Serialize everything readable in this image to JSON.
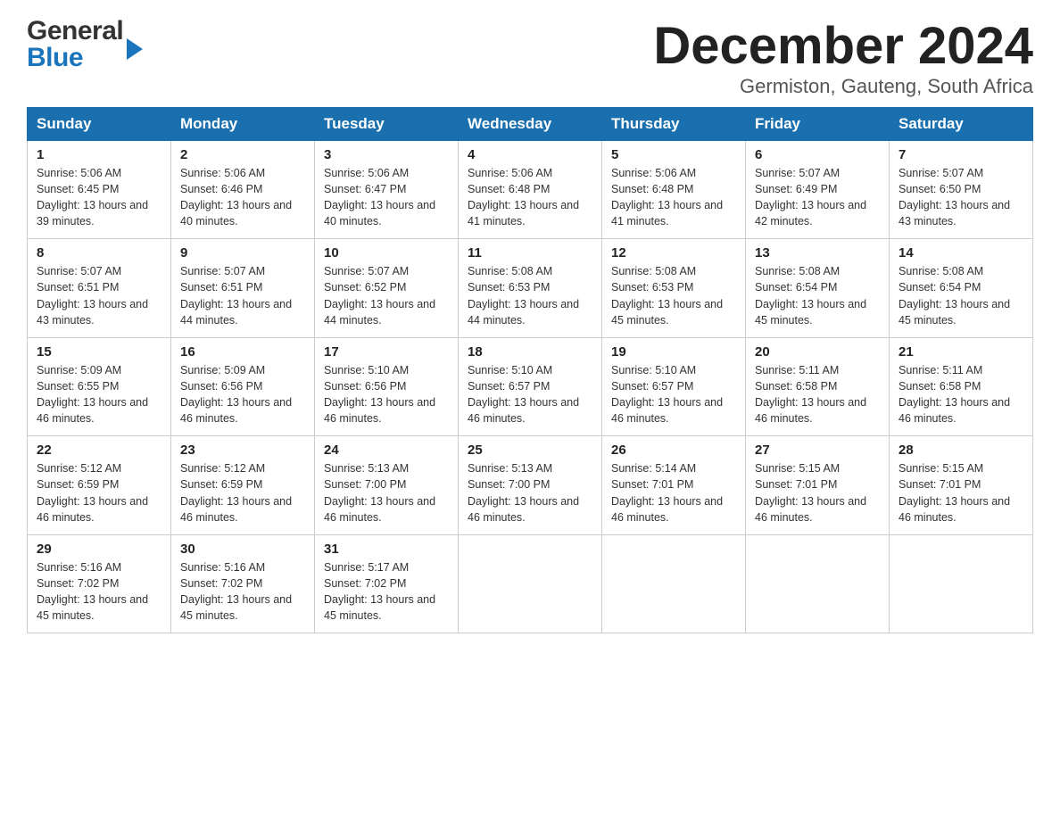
{
  "header": {
    "logo_general": "General",
    "logo_blue": "Blue",
    "month_title": "December 2024",
    "location": "Germiston, Gauteng, South Africa"
  },
  "calendar": {
    "days_of_week": [
      "Sunday",
      "Monday",
      "Tuesday",
      "Wednesday",
      "Thursday",
      "Friday",
      "Saturday"
    ],
    "weeks": [
      [
        {
          "day": "1",
          "sunrise": "5:06 AM",
          "sunset": "6:45 PM",
          "daylight": "13 hours and 39 minutes."
        },
        {
          "day": "2",
          "sunrise": "5:06 AM",
          "sunset": "6:46 PM",
          "daylight": "13 hours and 40 minutes."
        },
        {
          "day": "3",
          "sunrise": "5:06 AM",
          "sunset": "6:47 PM",
          "daylight": "13 hours and 40 minutes."
        },
        {
          "day": "4",
          "sunrise": "5:06 AM",
          "sunset": "6:48 PM",
          "daylight": "13 hours and 41 minutes."
        },
        {
          "day": "5",
          "sunrise": "5:06 AM",
          "sunset": "6:48 PM",
          "daylight": "13 hours and 41 minutes."
        },
        {
          "day": "6",
          "sunrise": "5:07 AM",
          "sunset": "6:49 PM",
          "daylight": "13 hours and 42 minutes."
        },
        {
          "day": "7",
          "sunrise": "5:07 AM",
          "sunset": "6:50 PM",
          "daylight": "13 hours and 43 minutes."
        }
      ],
      [
        {
          "day": "8",
          "sunrise": "5:07 AM",
          "sunset": "6:51 PM",
          "daylight": "13 hours and 43 minutes."
        },
        {
          "day": "9",
          "sunrise": "5:07 AM",
          "sunset": "6:51 PM",
          "daylight": "13 hours and 44 minutes."
        },
        {
          "day": "10",
          "sunrise": "5:07 AM",
          "sunset": "6:52 PM",
          "daylight": "13 hours and 44 minutes."
        },
        {
          "day": "11",
          "sunrise": "5:08 AM",
          "sunset": "6:53 PM",
          "daylight": "13 hours and 44 minutes."
        },
        {
          "day": "12",
          "sunrise": "5:08 AM",
          "sunset": "6:53 PM",
          "daylight": "13 hours and 45 minutes."
        },
        {
          "day": "13",
          "sunrise": "5:08 AM",
          "sunset": "6:54 PM",
          "daylight": "13 hours and 45 minutes."
        },
        {
          "day": "14",
          "sunrise": "5:08 AM",
          "sunset": "6:54 PM",
          "daylight": "13 hours and 45 minutes."
        }
      ],
      [
        {
          "day": "15",
          "sunrise": "5:09 AM",
          "sunset": "6:55 PM",
          "daylight": "13 hours and 46 minutes."
        },
        {
          "day": "16",
          "sunrise": "5:09 AM",
          "sunset": "6:56 PM",
          "daylight": "13 hours and 46 minutes."
        },
        {
          "day": "17",
          "sunrise": "5:10 AM",
          "sunset": "6:56 PM",
          "daylight": "13 hours and 46 minutes."
        },
        {
          "day": "18",
          "sunrise": "5:10 AM",
          "sunset": "6:57 PM",
          "daylight": "13 hours and 46 minutes."
        },
        {
          "day": "19",
          "sunrise": "5:10 AM",
          "sunset": "6:57 PM",
          "daylight": "13 hours and 46 minutes."
        },
        {
          "day": "20",
          "sunrise": "5:11 AM",
          "sunset": "6:58 PM",
          "daylight": "13 hours and 46 minutes."
        },
        {
          "day": "21",
          "sunrise": "5:11 AM",
          "sunset": "6:58 PM",
          "daylight": "13 hours and 46 minutes."
        }
      ],
      [
        {
          "day": "22",
          "sunrise": "5:12 AM",
          "sunset": "6:59 PM",
          "daylight": "13 hours and 46 minutes."
        },
        {
          "day": "23",
          "sunrise": "5:12 AM",
          "sunset": "6:59 PM",
          "daylight": "13 hours and 46 minutes."
        },
        {
          "day": "24",
          "sunrise": "5:13 AM",
          "sunset": "7:00 PM",
          "daylight": "13 hours and 46 minutes."
        },
        {
          "day": "25",
          "sunrise": "5:13 AM",
          "sunset": "7:00 PM",
          "daylight": "13 hours and 46 minutes."
        },
        {
          "day": "26",
          "sunrise": "5:14 AM",
          "sunset": "7:01 PM",
          "daylight": "13 hours and 46 minutes."
        },
        {
          "day": "27",
          "sunrise": "5:15 AM",
          "sunset": "7:01 PM",
          "daylight": "13 hours and 46 minutes."
        },
        {
          "day": "28",
          "sunrise": "5:15 AM",
          "sunset": "7:01 PM",
          "daylight": "13 hours and 46 minutes."
        }
      ],
      [
        {
          "day": "29",
          "sunrise": "5:16 AM",
          "sunset": "7:02 PM",
          "daylight": "13 hours and 45 minutes."
        },
        {
          "day": "30",
          "sunrise": "5:16 AM",
          "sunset": "7:02 PM",
          "daylight": "13 hours and 45 minutes."
        },
        {
          "day": "31",
          "sunrise": "5:17 AM",
          "sunset": "7:02 PM",
          "daylight": "13 hours and 45 minutes."
        },
        null,
        null,
        null,
        null
      ]
    ]
  }
}
